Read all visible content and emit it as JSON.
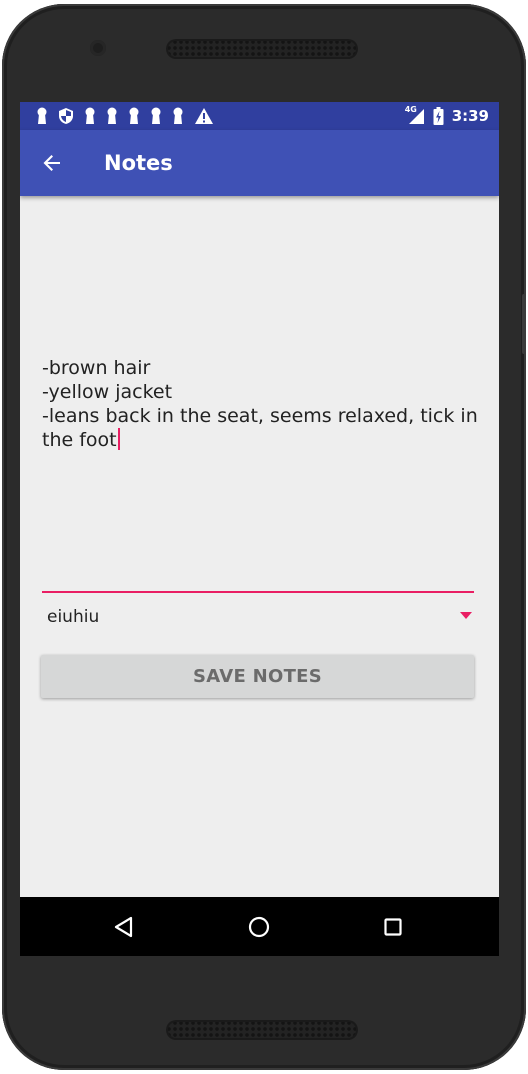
{
  "status_bar": {
    "time": "3:39",
    "network": "4G",
    "notification_icons": [
      "keyhole-icon",
      "shield-icon",
      "keyhole-icon",
      "keyhole-icon",
      "keyhole-icon",
      "keyhole-icon",
      "keyhole-icon",
      "warning-icon"
    ]
  },
  "app_bar": {
    "title": "Notes",
    "back_icon": "arrow-back-icon"
  },
  "notes": {
    "lines": [
      "-brown hair",
      "-yellow jacket",
      "-leans back in the seat, seems relaxed, tick in",
      "the foot"
    ]
  },
  "spinner": {
    "selected": "eiuhiu"
  },
  "save_button": {
    "label": "SAVE NOTES"
  },
  "nav_bar": {
    "icons": [
      "back-triangle-icon",
      "home-circle-icon",
      "recents-square-icon"
    ]
  },
  "colors": {
    "status_bar": "#303f9f",
    "app_bar": "#3f51b5",
    "accent": "#e91e63",
    "background": "#eeeeee",
    "button": "#d6d7d7"
  }
}
